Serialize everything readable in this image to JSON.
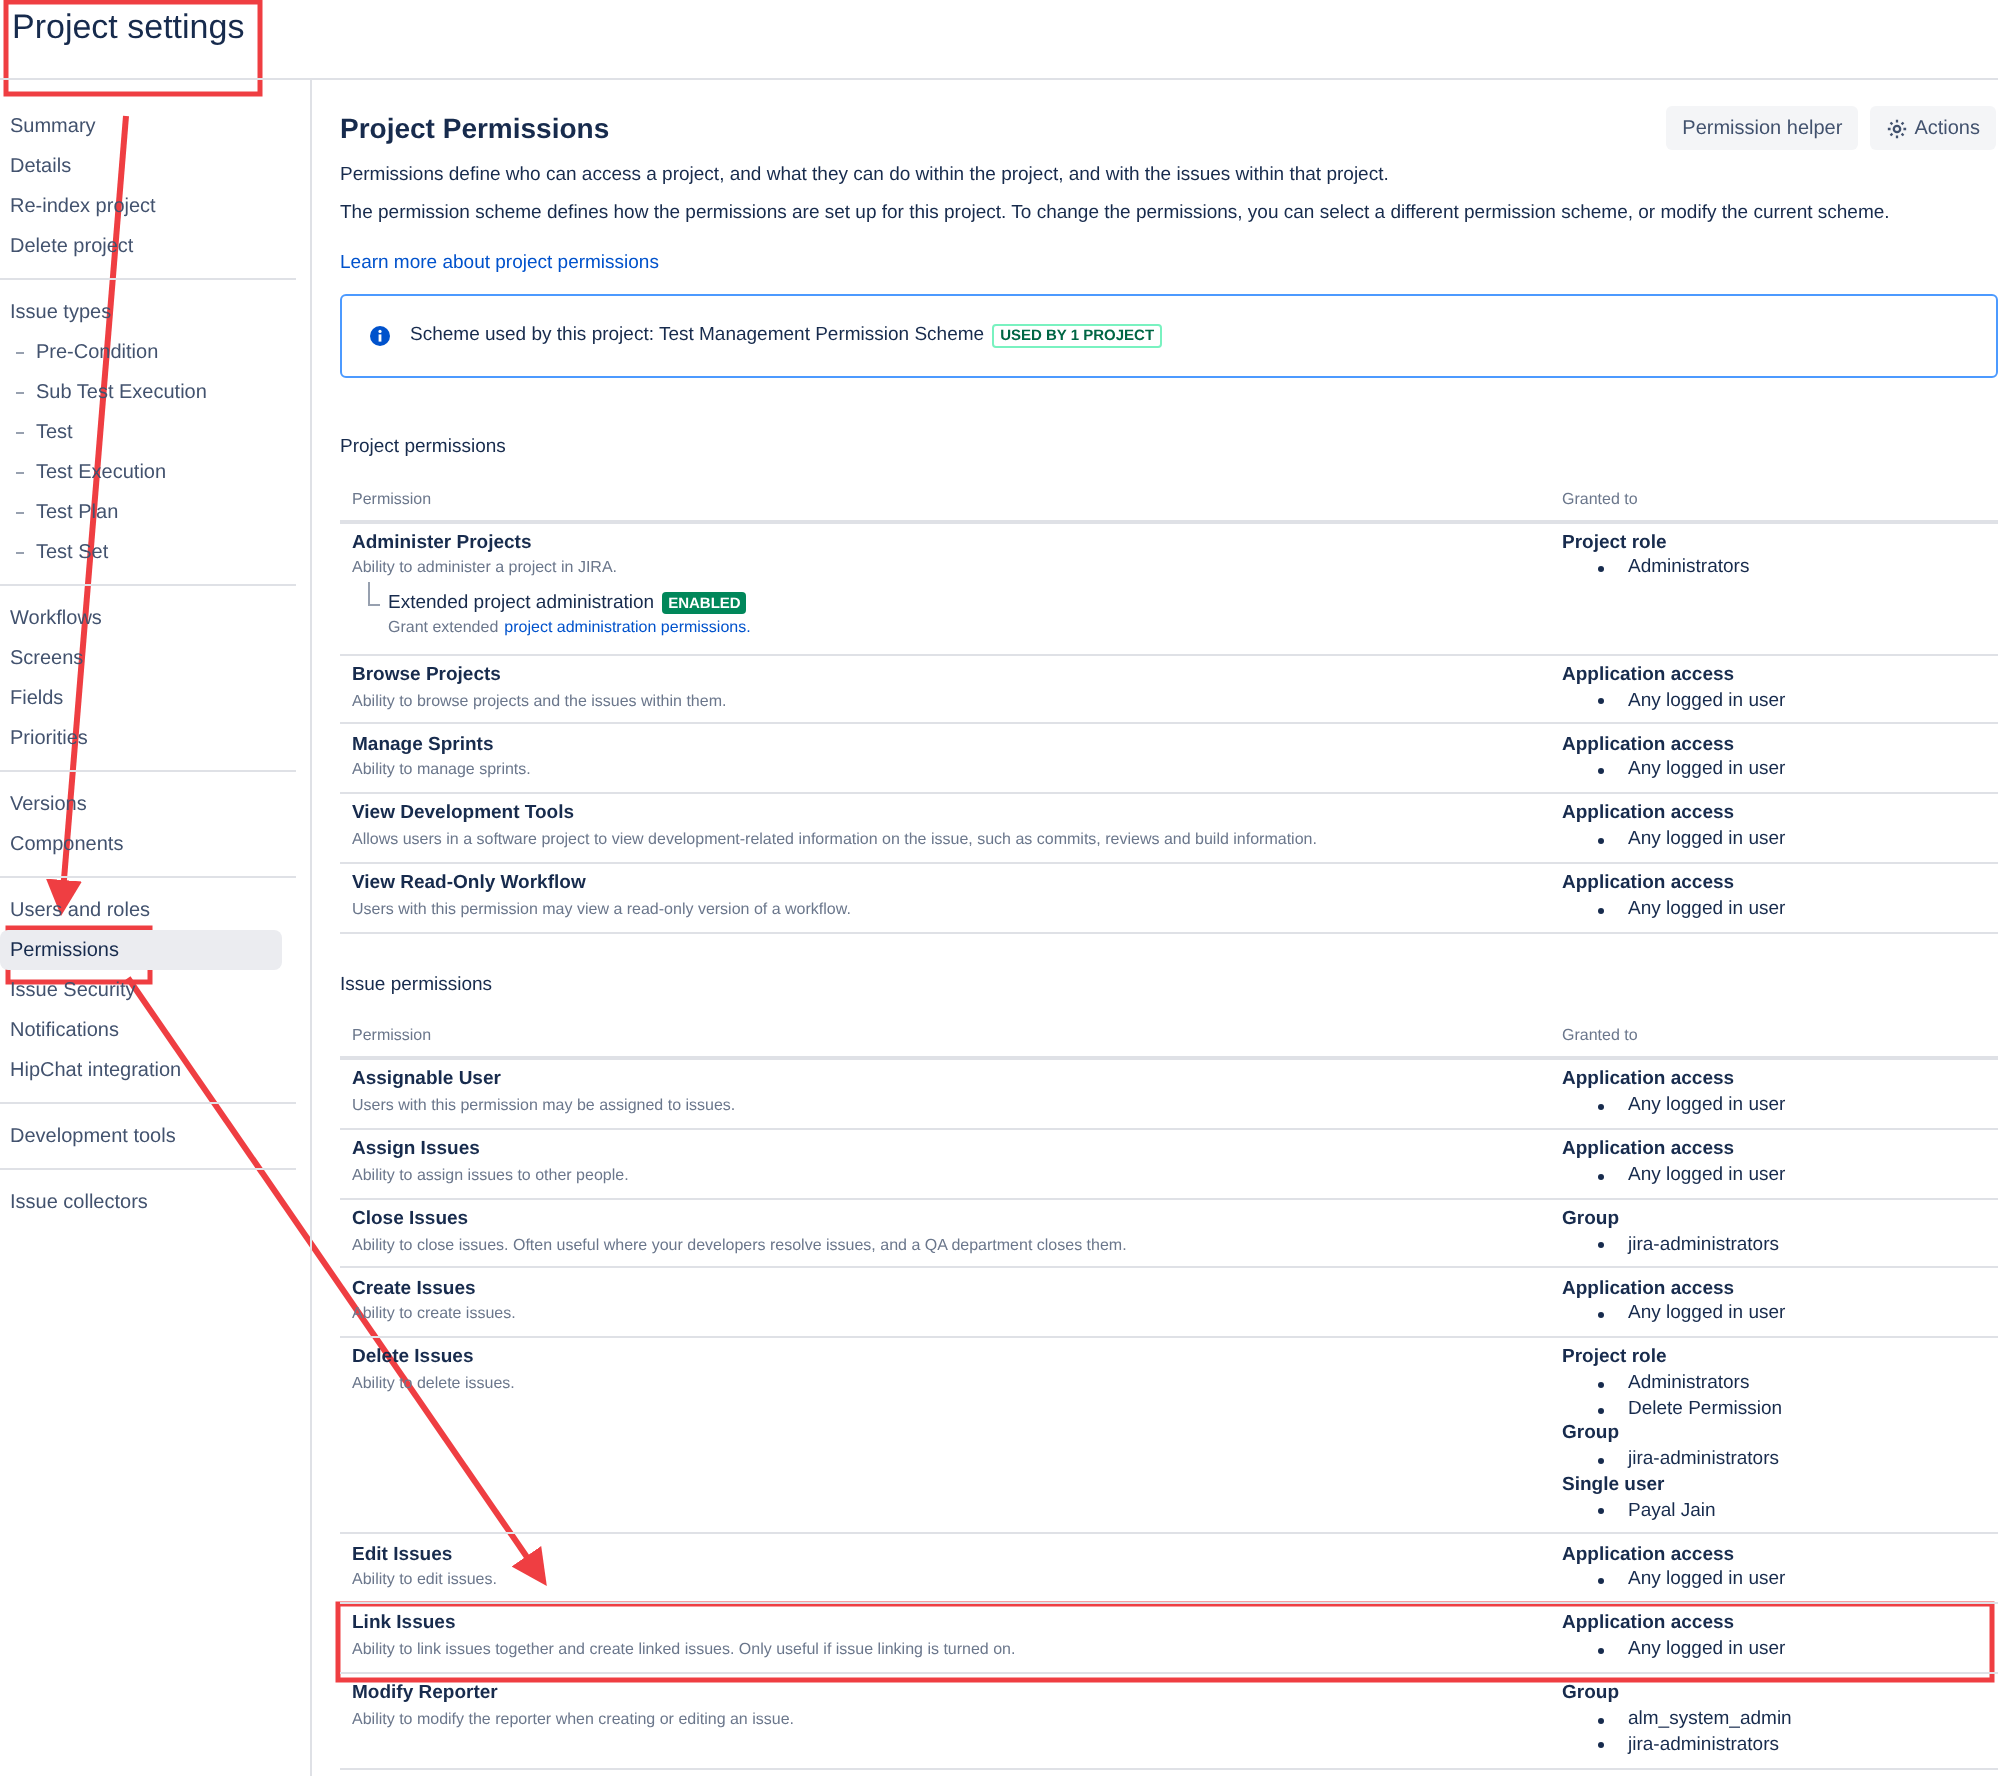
{
  "page_title": "Project settings",
  "sidebar": {
    "groups": [
      {
        "items": [
          {
            "label": "Summary",
            "selected": false
          },
          {
            "label": "Details",
            "selected": false
          },
          {
            "label": "Re-index project",
            "selected": false
          },
          {
            "label": "Delete project",
            "selected": false
          }
        ]
      },
      {
        "items": [
          {
            "label": "Issue types",
            "selected": false,
            "children": [
              {
                "label": "Pre-Condition",
                "selected": false
              },
              {
                "label": "Sub Test Execution",
                "selected": false
              },
              {
                "label": "Test",
                "selected": false
              },
              {
                "label": "Test Execution",
                "selected": false
              },
              {
                "label": "Test Plan",
                "selected": false
              },
              {
                "label": "Test Set",
                "selected": false
              }
            ]
          }
        ]
      },
      {
        "items": [
          {
            "label": "Workflows",
            "selected": false
          },
          {
            "label": "Screens",
            "selected": false
          },
          {
            "label": "Fields",
            "selected": false
          },
          {
            "label": "Priorities",
            "selected": false
          }
        ]
      },
      {
        "items": [
          {
            "label": "Versions",
            "selected": false
          },
          {
            "label": "Components",
            "selected": false
          }
        ]
      },
      {
        "items": [
          {
            "label": "Users and roles",
            "selected": false
          },
          {
            "label": "Permissions",
            "selected": true
          },
          {
            "label": "Issue Security",
            "selected": false
          },
          {
            "label": "Notifications",
            "selected": false
          },
          {
            "label": "HipChat integration",
            "selected": false
          }
        ]
      },
      {
        "items": [
          {
            "label": "Development tools",
            "selected": false
          }
        ]
      },
      {
        "items": [
          {
            "label": "Issue collectors",
            "selected": false
          }
        ]
      }
    ]
  },
  "main": {
    "title": "Project Permissions",
    "buttons": [
      {
        "label": "Permission helper",
        "kind": "plain"
      },
      {
        "label": "Actions",
        "kind": "gear"
      }
    ],
    "description": [
      "Permissions define who can access a project, and what they can do within the project, and with the issues within that project.",
      "The permission scheme defines how the permissions are set up for this project. To change the permissions, you can select a different permission scheme, or modify the current scheme."
    ],
    "link": "Learn more about project permissions",
    "info": {
      "text": "Scheme used by this project: Test Management Permission Scheme",
      "badge": "USED BY 1 PROJECT"
    },
    "sections": [
      {
        "heading": "Project permissions",
        "columns": [
          "Permission",
          "Granted to"
        ],
        "rows": [
          {
            "name": "Administer Projects",
            "description": "Ability to administer a project in JIRA.",
            "extension": {
              "label": "Extended project administration",
              "badge": "ENABLED",
              "note": "Grant extended",
              "link": "project administration permissions."
            },
            "grants": [
              {
                "type": "Project role",
                "members": [
                  "Administrators"
                ]
              }
            ]
          },
          {
            "name": "Browse Projects",
            "description": "Ability to browse projects and the issues within them.",
            "grants": [
              {
                "type": "Application access",
                "members": [
                  "Any logged in user"
                ]
              }
            ]
          },
          {
            "name": "Manage Sprints",
            "description": "Ability to manage sprints.",
            "grants": [
              {
                "type": "Application access",
                "members": [
                  "Any logged in user"
                ]
              }
            ]
          },
          {
            "name": "View Development Tools",
            "description": "Allows users in a software project to view development-related information on the issue, such as commits, reviews and build information.",
            "grants": [
              {
                "type": "Application access",
                "members": [
                  "Any logged in user"
                ]
              }
            ]
          },
          {
            "name": "View Read-Only Workflow",
            "description": "Users with this permission may view a read-only version of a workflow.",
            "grants": [
              {
                "type": "Application access",
                "members": [
                  "Any logged in user"
                ]
              }
            ]
          }
        ]
      },
      {
        "heading": "Issue permissions",
        "columns": [
          "Permission",
          "Granted to"
        ],
        "rows": [
          {
            "name": "Assignable User",
            "description": "Users with this permission may be assigned to issues.",
            "grants": [
              {
                "type": "Application access",
                "members": [
                  "Any logged in user"
                ]
              }
            ]
          },
          {
            "name": "Assign Issues",
            "description": "Ability to assign issues to other people.",
            "grants": [
              {
                "type": "Application access",
                "members": [
                  "Any logged in user"
                ]
              }
            ]
          },
          {
            "name": "Close Issues",
            "description": "Ability to close issues. Often useful where your developers resolve issues, and a QA department closes them.",
            "grants": [
              {
                "type": "Group",
                "members": [
                  "jira-administrators"
                ]
              }
            ]
          },
          {
            "name": "Create Issues",
            "description": "Ability to create issues.",
            "grants": [
              {
                "type": "Application access",
                "members": [
                  "Any logged in user"
                ]
              }
            ]
          },
          {
            "name": "Delete Issues",
            "description": "Ability to delete issues.",
            "grants": [
              {
                "type": "Project role",
                "members": [
                  "Administrators",
                  "Delete Permission"
                ]
              },
              {
                "type": "Group",
                "members": [
                  "jira-administrators"
                ]
              },
              {
                "type": "Single user",
                "members": [
                  "Payal Jain"
                ]
              }
            ]
          },
          {
            "name": "Edit Issues",
            "description": "Ability to edit issues.",
            "grants": [
              {
                "type": "Application access",
                "members": [
                  "Any logged in user"
                ]
              }
            ]
          },
          {
            "name": "Link Issues",
            "description": "Ability to link issues together and create linked issues. Only useful if issue linking is turned on.",
            "grants": [
              {
                "type": "Application access",
                "members": [
                  "Any logged in user"
                ]
              }
            ]
          },
          {
            "name": "Modify Reporter",
            "description": "Ability to modify the reporter when creating or editing an issue.",
            "grants": [
              {
                "type": "Group",
                "members": [
                  "alm_system_admin",
                  "jira-administrators"
                ]
              }
            ]
          }
        ]
      }
    ]
  }
}
